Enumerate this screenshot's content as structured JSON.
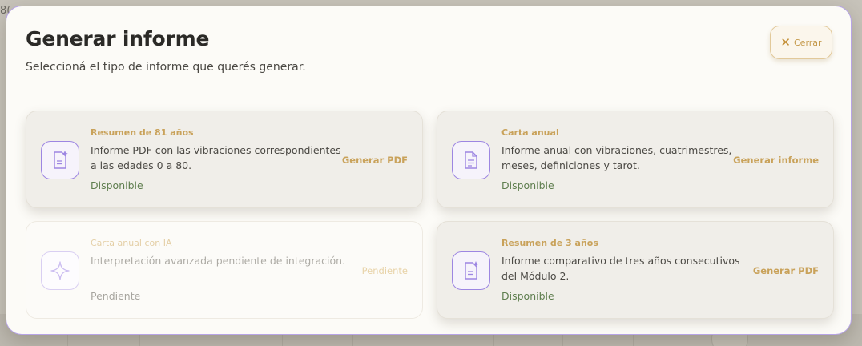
{
  "background": {
    "corner_text": "8("
  },
  "modal": {
    "title": "Generar informe",
    "subtitle": "Seleccioná el tipo de informe que querés generar.",
    "close_label": "Cerrar",
    "close_icon": "close-icon"
  },
  "cards": [
    {
      "eyebrow": "Resumen de 81 años",
      "description": "Informe PDF con las vibraciones correspondientes a las edades 0 a 80.",
      "status": "Disponible",
      "action": "Generar PDF",
      "icon": "document-sparkle-icon",
      "enabled": true
    },
    {
      "eyebrow": "Carta anual",
      "description": "Informe anual con vibraciones, cuatrimestres, meses, definiciones y tarot.",
      "status": "Disponible",
      "action": "Generar informe",
      "icon": "document-icon",
      "enabled": true
    },
    {
      "eyebrow": "Carta anual con IA",
      "description": "Interpretación avanzada pendiente de integración.",
      "status": "Pendiente",
      "action": "Pendiente",
      "icon": "sparkle-icon",
      "enabled": false
    },
    {
      "eyebrow": "Resumen de 3 años",
      "description": "Informe comparativo de tres años consecutivos del Módulo 2.",
      "status": "Disponible",
      "action": "Generar PDF",
      "icon": "document-sparkle-icon",
      "enabled": true
    }
  ],
  "colors": {
    "accent_gold": "#c9a25a",
    "accent_purple": "#9d86e2",
    "status_green": "#5f7e4f",
    "modal_border": "#b7a4e6"
  }
}
